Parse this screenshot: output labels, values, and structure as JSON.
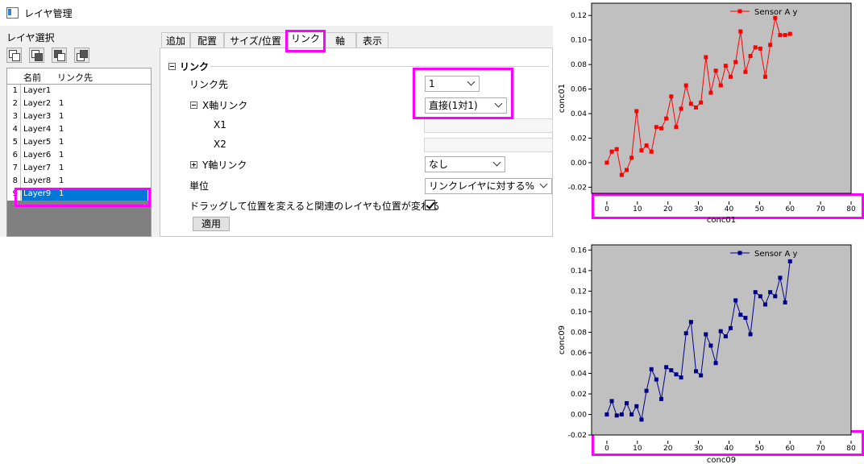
{
  "window": {
    "title": "レイヤ管理"
  },
  "layer_select": {
    "label": "レイヤ選択",
    "buttons": [
      "layer-arrange-icon-1",
      "layer-arrange-icon-2",
      "layer-arrange-icon-3",
      "layer-arrange-icon-4"
    ],
    "columns": [
      "名前",
      "リンク先"
    ],
    "rows": [
      {
        "num": "1",
        "name": "Layer1",
        "link": ""
      },
      {
        "num": "2",
        "name": "Layer2",
        "link": "1"
      },
      {
        "num": "3",
        "name": "Layer3",
        "link": "1"
      },
      {
        "num": "4",
        "name": "Layer4",
        "link": "1"
      },
      {
        "num": "5",
        "name": "Layer5",
        "link": "1"
      },
      {
        "num": "6",
        "name": "Layer6",
        "link": "1"
      },
      {
        "num": "7",
        "name": "Layer7",
        "link": "1"
      },
      {
        "num": "8",
        "name": "Layer8",
        "link": "1"
      },
      {
        "num": "9",
        "name": "Layer9",
        "link": "1"
      }
    ],
    "selected_row": "Layer9"
  },
  "tabs": [
    {
      "label": "追加"
    },
    {
      "label": "配置"
    },
    {
      "label": "サイズ/位置"
    },
    {
      "label": "リンク"
    },
    {
      "label": "軸"
    },
    {
      "label": "表示"
    }
  ],
  "active_tab": "リンク",
  "link_panel": {
    "section_title": "リンク",
    "link_to_label": "リンク先",
    "link_to_value": "1",
    "x_link_label": "X軸リンク",
    "x_link_value": "直接(1対1)",
    "x1_label": "X1",
    "x2_label": "X2",
    "y_link_label": "Y軸リンク",
    "y_link_value": "なし",
    "unit_label": "単位",
    "unit_value": "リンクレイヤに対する%",
    "drag_label": "ドラッグして位置を変えると関連のレイヤも位置が変わる",
    "drag_checked": true,
    "apply_button": "適用"
  },
  "colors": {
    "highlight": "#ff00ff",
    "selection": "#0078d7",
    "plot_bg": "#c0c0c0",
    "series_top": "#ff0000",
    "series_bottom": "#00008b"
  },
  "chart_data": [
    {
      "type": "line",
      "xlabel": "conc01",
      "ylabel": "conc01",
      "legend": "Sensor A y",
      "legend_position": "top-right",
      "xlim": [
        -5,
        80
      ],
      "ylim": [
        -0.025,
        0.13
      ],
      "xticks": [
        "0",
        "10",
        "20",
        "30",
        "40",
        "50",
        "60",
        "70",
        "80"
      ],
      "yticks": [
        "-0.02",
        "0.00",
        "0.02",
        "0.04",
        "0.06",
        "0.08",
        "0.10",
        "0.12"
      ],
      "x": [
        0,
        2,
        4,
        6,
        8,
        10,
        12,
        14,
        16,
        18,
        20,
        22,
        24,
        26,
        28,
        30,
        32,
        34,
        36,
        38,
        40,
        42,
        44,
        46,
        48,
        50,
        52,
        54,
        56,
        58,
        60
      ],
      "y": [
        0.0,
        0.009,
        0.011,
        -0.01,
        -0.006,
        0.004,
        0.042,
        0.01,
        0.014,
        0.009,
        0.029,
        0.028,
        0.036,
        0.054,
        0.029,
        0.044,
        0.063,
        0.048,
        0.045,
        0.049,
        0.086,
        0.057,
        0.075,
        0.063,
        0.079,
        0.07,
        0.082,
        0.107,
        0.074,
        0.087,
        0.094,
        0.093,
        0.07,
        0.096,
        0.118,
        0.104,
        0.104,
        0.105
      ],
      "series_color": "#ff0000"
    },
    {
      "type": "line",
      "xlabel": "conc09",
      "ylabel": "conc09",
      "legend": "Sensor A y",
      "legend_position": "top-right",
      "xlim": [
        -5,
        80
      ],
      "ylim": [
        -0.02,
        0.165
      ],
      "xticks": [
        "0",
        "10",
        "20",
        "30",
        "40",
        "50",
        "60",
        "70",
        "80"
      ],
      "yticks": [
        "-0.02",
        "0.00",
        "0.02",
        "0.04",
        "0.06",
        "0.08",
        "0.10",
        "0.12",
        "0.14",
        "0.16"
      ],
      "x": [
        0,
        2,
        4,
        6,
        8,
        10,
        12,
        14,
        16,
        18,
        20,
        22,
        24,
        26,
        28,
        30,
        32,
        34,
        36,
        38,
        40,
        42,
        44,
        46,
        48,
        50,
        52,
        54,
        56,
        58,
        60
      ],
      "y": [
        0.0,
        0.013,
        -0.001,
        0.0,
        0.011,
        0.0,
        0.008,
        -0.005,
        0.023,
        0.044,
        0.034,
        0.015,
        0.046,
        0.043,
        0.039,
        0.036,
        0.079,
        0.09,
        0.042,
        0.038,
        0.078,
        0.067,
        0.05,
        0.081,
        0.076,
        0.084,
        0.111,
        0.097,
        0.094,
        0.078,
        0.119,
        0.115,
        0.107,
        0.119,
        0.115,
        0.133,
        0.109,
        0.149
      ],
      "series_color": "#00008b"
    }
  ]
}
